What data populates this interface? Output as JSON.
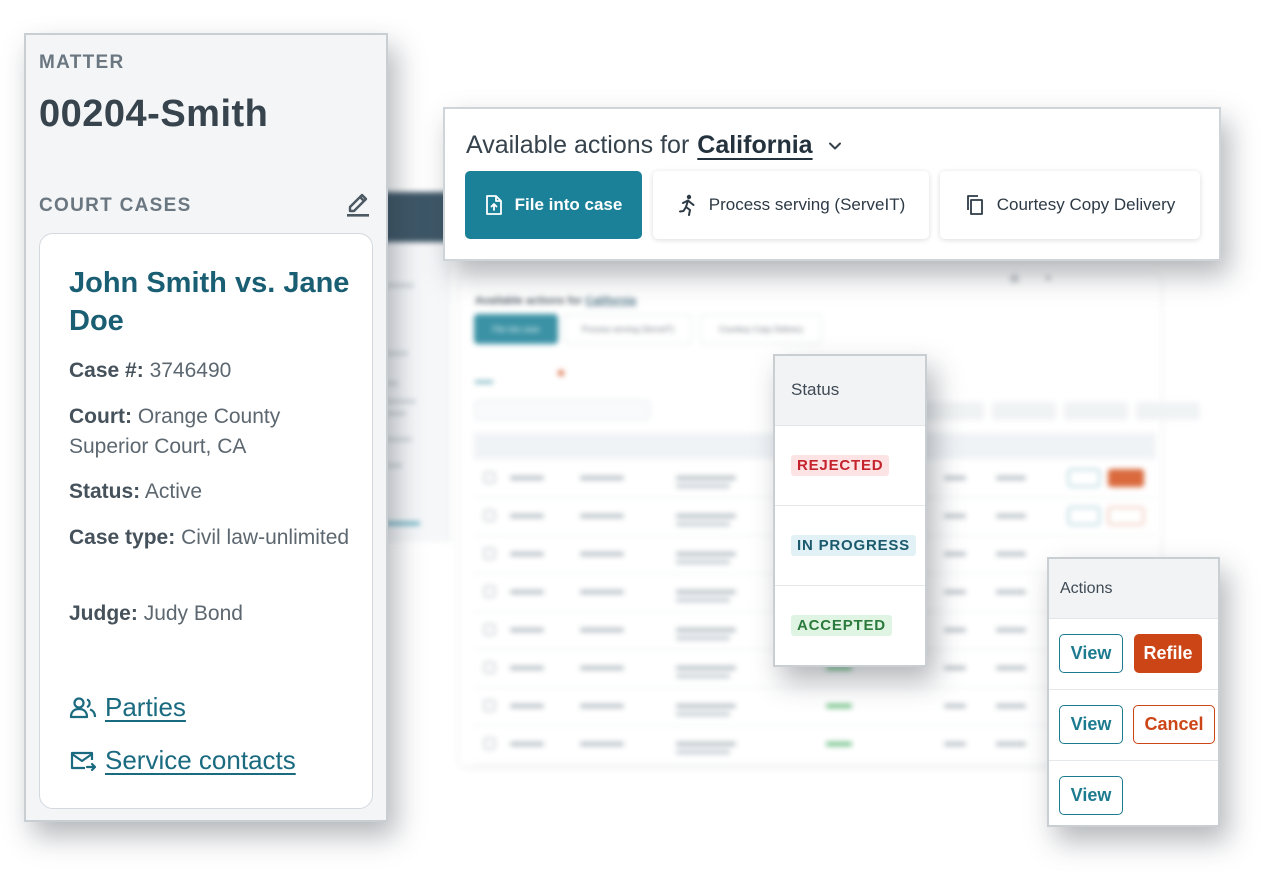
{
  "matter": {
    "label": "MATTER",
    "title": "00204-Smith",
    "court_cases_label": "COURT CASES",
    "case": {
      "title": "John Smith vs. Jane Doe",
      "case_no_label": "Case #:",
      "case_no": "3746490",
      "court_label": "Court:",
      "court": "Orange County Superior Court, CA",
      "status_label": "Status:",
      "status": "Active",
      "type_label": "Case type:",
      "type": "Civil law-unlimited",
      "judge_label": "Judge:",
      "judge": "Judy Bond"
    },
    "links": {
      "parties": "Parties",
      "service_contacts": "Service contacts"
    }
  },
  "available_actions": {
    "prefix": "Available actions for",
    "state": "California",
    "buttons": {
      "file_into_case": "File into case",
      "process_serving": "Process serving (ServeIT)",
      "courtesy_copy": "Courtesy Copy Delivery"
    }
  },
  "status_column": {
    "header": "Status",
    "rows": [
      "REJECTED",
      "IN PROGRESS",
      "ACCEPTED"
    ]
  },
  "actions_column": {
    "header": "Actions",
    "view": "View",
    "refile": "Refile",
    "cancel": "Cancel"
  },
  "colors": {
    "primary": "#1b8198",
    "link": "#1a6a80",
    "danger": "#cc4516",
    "rejected_bg": "#fde3e3",
    "in_progress_bg": "#e1f1f6",
    "accepted_bg": "#e0f4e4"
  },
  "icons": {
    "edit": "pencil-icon",
    "file_into_case": "file-upload-icon",
    "process_serving": "runner-icon",
    "courtesy_copy": "copy-icon",
    "parties": "people-icon",
    "service_contacts": "mail-forward-icon",
    "state_dropdown": "chevron-down-icon"
  }
}
